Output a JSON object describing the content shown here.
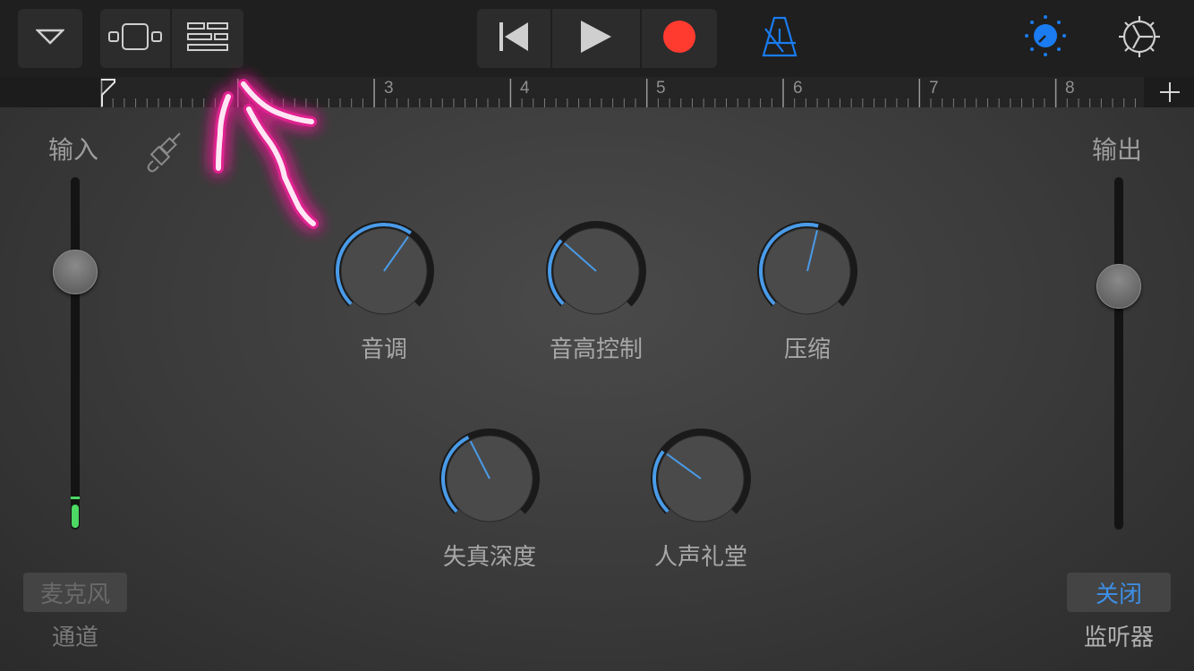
{
  "toolbar": {
    "icons": {
      "browser": "chevron-down-icon",
      "view_single": "track-view-icon",
      "view_tracks": "tracks-list-icon",
      "rewind": "rewind-icon",
      "play": "play-icon",
      "record": "record-icon",
      "metronome": "metronome-icon",
      "master_effects": "master-effects-knob-icon",
      "settings": "settings-gear-icon"
    },
    "colors": {
      "record": "#ff3b30",
      "accent": "#1a7cf0"
    }
  },
  "ruler": {
    "bars": [
      "3",
      "4",
      "5",
      "6",
      "7",
      "8"
    ],
    "add_section": "+"
  },
  "input": {
    "label": "输入",
    "level": 0.73,
    "source_button": "麦克风",
    "source_sub": "通道",
    "meter_color": "#4cd964"
  },
  "output": {
    "label": "输出",
    "level": 0.69,
    "monitor_button": "关闭",
    "monitor_sub": "监听器"
  },
  "knobs": [
    {
      "label": "音调",
      "value": 0.63
    },
    {
      "label": "音高控制",
      "value": 0.32
    },
    {
      "label": "压缩",
      "value": 0.55
    },
    {
      "label": "失真深度",
      "value": 0.4
    },
    {
      "label": "人声礼堂",
      "value": 0.3
    }
  ],
  "colors": {
    "knob_arc": "#4a9be8",
    "annotation": "#e0208f"
  }
}
